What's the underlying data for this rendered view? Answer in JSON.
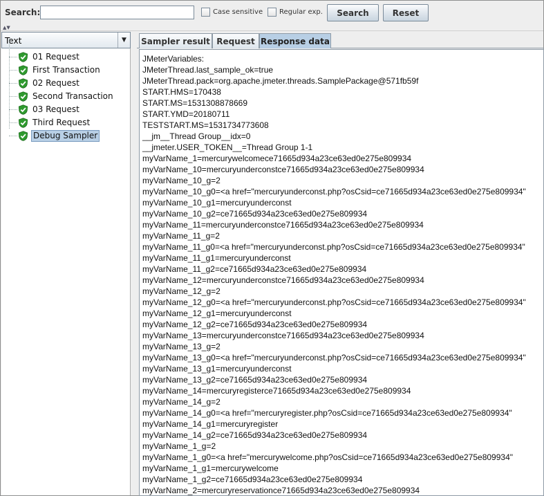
{
  "search": {
    "label": "Search:",
    "value": "",
    "placeholder": "",
    "case_sensitive_label": "Case sensitive",
    "regular_exp_label": "Regular exp.",
    "search_button": "Search",
    "reset_button": "Reset"
  },
  "left_panel": {
    "renderer_selected": "Text",
    "tree_items": [
      {
        "label": "01 Request",
        "icon": "green-shield-check-icon",
        "selected": false
      },
      {
        "label": "First Transaction",
        "icon": "green-shield-check-icon",
        "selected": false
      },
      {
        "label": "02 Request",
        "icon": "green-shield-check-icon",
        "selected": false
      },
      {
        "label": "Second Transaction",
        "icon": "green-shield-check-icon",
        "selected": false
      },
      {
        "label": "03 Request",
        "icon": "green-shield-check-icon",
        "selected": false
      },
      {
        "label": "Third Request",
        "icon": "green-shield-check-icon",
        "selected": false
      },
      {
        "label": "Debug Sampler",
        "icon": "green-shield-check-icon",
        "selected": true
      }
    ]
  },
  "tabs": [
    {
      "label": "Sampler result",
      "active": false
    },
    {
      "label": "Request",
      "active": false
    },
    {
      "label": "Response data",
      "active": true
    }
  ],
  "response_lines": [
    "JMeterVariables:",
    "JMeterThread.last_sample_ok=true",
    "JMeterThread.pack=org.apache.jmeter.threads.SamplePackage@571fb59f",
    "START.HMS=170438",
    "START.MS=1531308878669",
    "START.YMD=20180711",
    "TESTSTART.MS=1531734773608",
    "__jm__Thread Group__idx=0",
    "__jmeter.USER_TOKEN__=Thread Group 1-1",
    "myVarName_1=mercurywelcomece71665d934a23ce63ed0e275e809934",
    "myVarName_10=mercuryunderconstce71665d934a23ce63ed0e275e809934",
    "myVarName_10_g=2",
    "myVarName_10_g0=<a href=\"mercuryunderconst.php?osCsid=ce71665d934a23ce63ed0e275e809934\"",
    "myVarName_10_g1=mercuryunderconst",
    "myVarName_10_g2=ce71665d934a23ce63ed0e275e809934",
    "myVarName_11=mercuryunderconstce71665d934a23ce63ed0e275e809934",
    "myVarName_11_g=2",
    "myVarName_11_g0=<a href=\"mercuryunderconst.php?osCsid=ce71665d934a23ce63ed0e275e809934\"",
    "myVarName_11_g1=mercuryunderconst",
    "myVarName_11_g2=ce71665d934a23ce63ed0e275e809934",
    "myVarName_12=mercuryunderconstce71665d934a23ce63ed0e275e809934",
    "myVarName_12_g=2",
    "myVarName_12_g0=<a href=\"mercuryunderconst.php?osCsid=ce71665d934a23ce63ed0e275e809934\"",
    "myVarName_12_g1=mercuryunderconst",
    "myVarName_12_g2=ce71665d934a23ce63ed0e275e809934",
    "myVarName_13=mercuryunderconstce71665d934a23ce63ed0e275e809934",
    "myVarName_13_g=2",
    "myVarName_13_g0=<a href=\"mercuryunderconst.php?osCsid=ce71665d934a23ce63ed0e275e809934\"",
    "myVarName_13_g1=mercuryunderconst",
    "myVarName_13_g2=ce71665d934a23ce63ed0e275e809934",
    "myVarName_14=mercuryregisterce71665d934a23ce63ed0e275e809934",
    "myVarName_14_g=2",
    "myVarName_14_g0=<a href=\"mercuryregister.php?osCsid=ce71665d934a23ce63ed0e275e809934\"",
    "myVarName_14_g1=mercuryregister",
    "myVarName_14_g2=ce71665d934a23ce63ed0e275e809934",
    "myVarName_1_g=2",
    "myVarName_1_g0=<a href=\"mercurywelcome.php?osCsid=ce71665d934a23ce63ed0e275e809934\"",
    "myVarName_1_g1=mercurywelcome",
    "myVarName_1_g2=ce71665d934a23ce63ed0e275e809934",
    "myVarName_2=mercuryreservationce71665d934a23ce63ed0e275e809934"
  ]
}
